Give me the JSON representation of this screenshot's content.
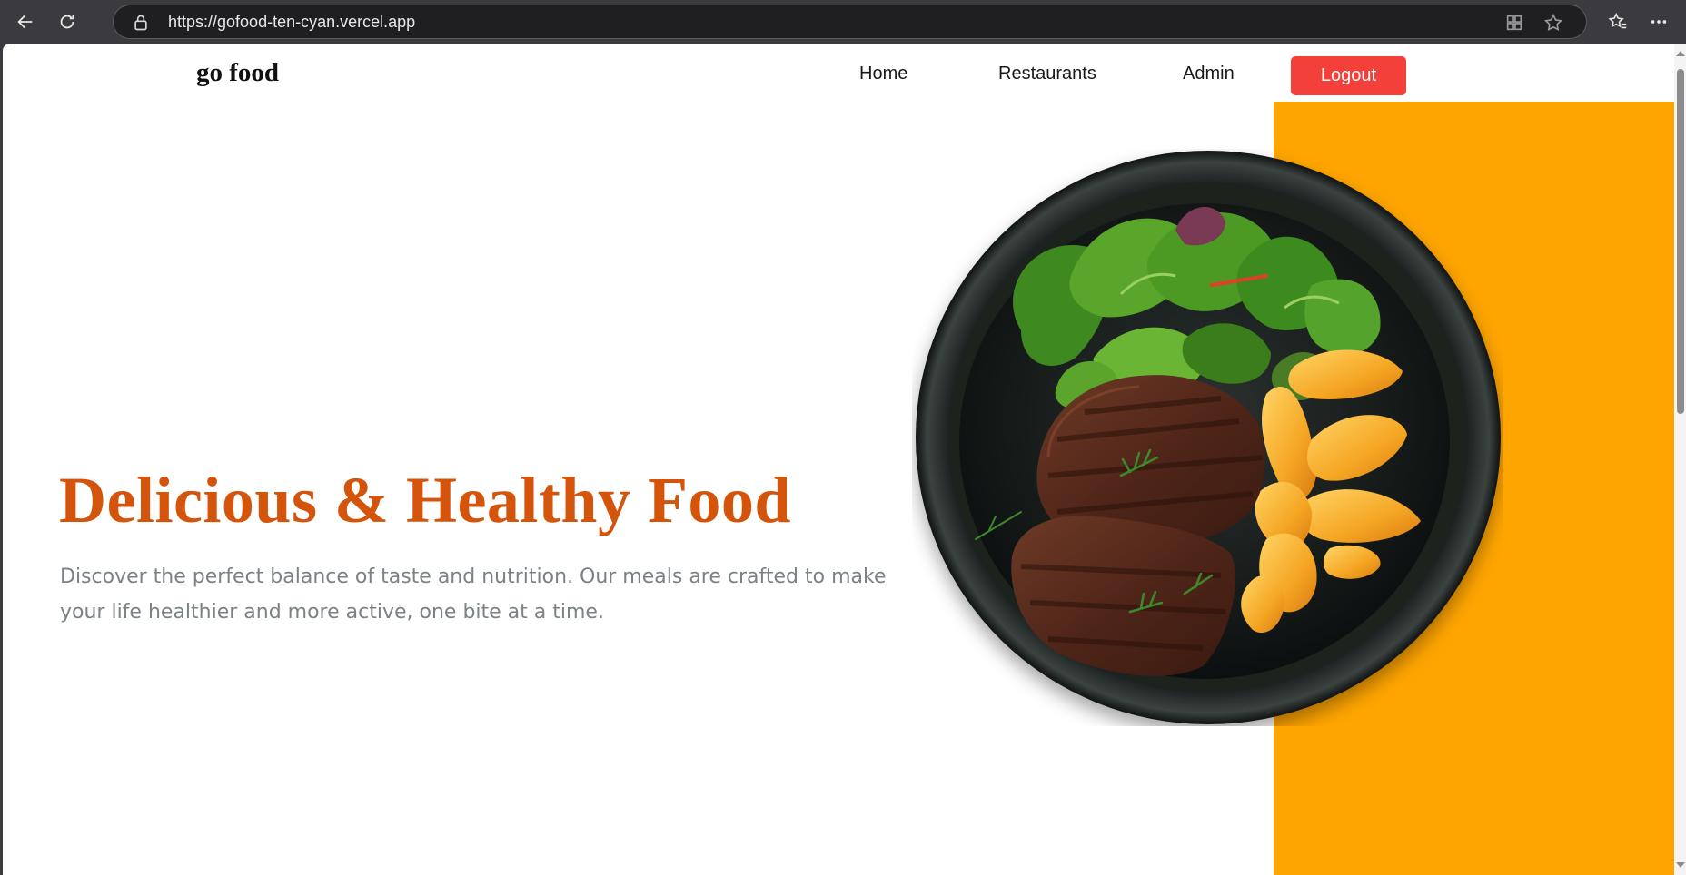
{
  "browser": {
    "url": "https://gofood-ten-cyan.vercel.app",
    "icons": [
      "back-icon",
      "reload-icon",
      "lock-icon",
      "apps-icon",
      "star-icon",
      "favorites-icon",
      "more-icon"
    ]
  },
  "nav": {
    "brand": "go food",
    "links": [
      {
        "label": "Home"
      },
      {
        "label": "Restaurants"
      },
      {
        "label": "Admin"
      }
    ],
    "logout_label": "Logout"
  },
  "hero": {
    "title": "Delicious & Healthy Food",
    "description": "Discover the perfect balance of taste and nutrition. Our meals are crafted to make your life healthier and more active, one bite at a time.",
    "image_subject": "steak-with-salad-and-potato-wedges"
  },
  "colors": {
    "accent_orange": "#FFA500",
    "title_orange": "#D4540B",
    "logout_red": "#F4403A"
  }
}
